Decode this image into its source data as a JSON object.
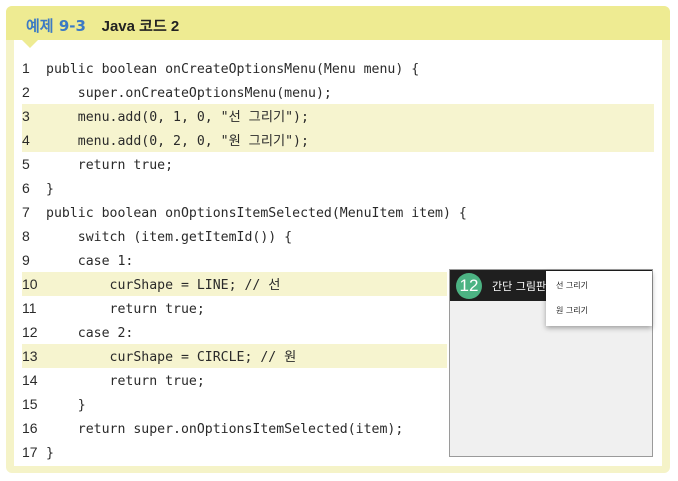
{
  "header": {
    "example_label": "예제 9-3",
    "title": "Java 코드 2"
  },
  "code_lines": [
    {
      "n": "1",
      "text": "public boolean onCreateOptionsMenu(Menu menu) {"
    },
    {
      "n": "2",
      "text": "    super.onCreateOptionsMenu(menu);"
    },
    {
      "n": "3",
      "text": "    menu.add(0, 1, 0, \"선 그리기\");"
    },
    {
      "n": "4",
      "text": "    menu.add(0, 2, 0, \"원 그리기\");"
    },
    {
      "n": "5",
      "text": "    return true;"
    },
    {
      "n": "6",
      "text": "}"
    },
    {
      "n": "7",
      "text": "public boolean onOptionsItemSelected(MenuItem item) {"
    },
    {
      "n": "8",
      "text": "    switch (item.getItemId()) {"
    },
    {
      "n": "9",
      "text": "    case 1:"
    },
    {
      "n": "10",
      "text": "        curShape = LINE; // 선"
    },
    {
      "n": "11",
      "text": "        return true;"
    },
    {
      "n": "12",
      "text": "    case 2:"
    },
    {
      "n": "13",
      "text": "        curShape = CIRCLE; // 원"
    },
    {
      "n": "14",
      "text": "        return true;"
    },
    {
      "n": "15",
      "text": "    }"
    },
    {
      "n": "16",
      "text": "    return super.onOptionsItemSelected(item);"
    },
    {
      "n": "17",
      "text": "}"
    }
  ],
  "phone": {
    "badge": "12",
    "app_title": "간단 그림판",
    "menu_items": [
      "선 그리기",
      "원 그리기"
    ]
  },
  "colors": {
    "frame": "#f5f3c8",
    "header": "#eeeb92",
    "highlight": "#f6f4cf",
    "example_label": "#3c7ac4",
    "badge": "#4cb383",
    "app_bar": "#1f1f1f"
  }
}
